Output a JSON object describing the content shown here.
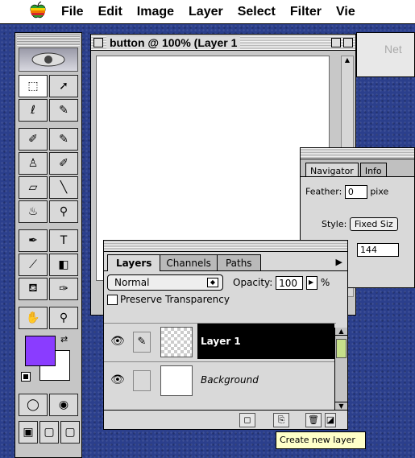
{
  "menubar": {
    "apple_icon": "apple-icon",
    "items": [
      "File",
      "Edit",
      "Image",
      "Layer",
      "Select",
      "Filter",
      "Vie"
    ]
  },
  "document_window": {
    "title": "button @ 100% (Layer 1"
  },
  "background_window": {
    "title": "Net"
  },
  "navigator_palette": {
    "tabs": [
      "Navigator",
      "Info"
    ],
    "feather_label": "Feather:",
    "feather_value": "0",
    "feather_unit": "pixe",
    "style_label": "Style:",
    "style_value": "Fixed Siz",
    "size_value": "144"
  },
  "layers_palette": {
    "tabs": [
      "Layers",
      "Channels",
      "Paths"
    ],
    "blend_mode": "Normal",
    "opacity_label": "Opacity:",
    "opacity_value": "100",
    "opacity_unit": "%",
    "preserve_transparency": "Preserve Transparency",
    "layers": [
      {
        "name": "Layer 1",
        "selected": true
      },
      {
        "name": "Background",
        "selected": false
      }
    ]
  },
  "tooltip": "Create new layer",
  "colors": {
    "foreground": "#8a3cff",
    "background": "#ffffff",
    "desktop": "#2b3f8c"
  }
}
